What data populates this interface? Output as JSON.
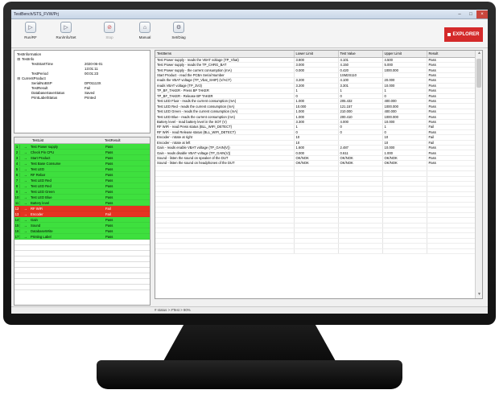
{
  "window": {
    "title": "TestBench/STS_FVW/Prj"
  },
  "toolbar": {
    "buttons": [
      {
        "label": "Run/RF",
        "icon": "play-icon",
        "glyph": "▷"
      },
      {
        "label": "Run/Info/Set",
        "icon": "play-icon",
        "glyph": "▷"
      },
      {
        "label": "Stop",
        "icon": "stop-icon",
        "glyph": "⊘"
      },
      {
        "label": "Manual",
        "icon": "home-icon",
        "glyph": "⌂"
      },
      {
        "label": "Set/Diag",
        "icon": "gear-icon",
        "glyph": "⚙"
      }
    ]
  },
  "brand": {
    "label": "EXPLORER",
    "color": "#d42a2a"
  },
  "test_info": {
    "header": "TestInformation",
    "rows": [
      {
        "key": "TestInfo",
        "value": "",
        "indent": 1,
        "expander": "⊟"
      },
      {
        "key": "TestStartTime",
        "value": "2020-06-01",
        "indent": 3,
        "expander": ""
      },
      {
        "key": "",
        "value": "13:01:11",
        "indent": 3,
        "expander": ""
      },
      {
        "key": "TestPeriod",
        "value": "00:01:23",
        "indent": 3,
        "expander": ""
      },
      {
        "key": "CurrentProduct",
        "value": "",
        "indent": 1,
        "expander": "⊟"
      },
      {
        "key": "SerialNoBSP",
        "value": "DP01113X",
        "indent": 3,
        "expander": ""
      },
      {
        "key": "TestResult",
        "value": "Fail",
        "indent": 3,
        "expander": ""
      },
      {
        "key": "DatabaseSaveStatus",
        "value": "Saved",
        "indent": 3,
        "expander": ""
      },
      {
        "key": "PrintLabelStatus",
        "value": "Printed",
        "indent": 3,
        "expander": ""
      }
    ]
  },
  "test_list": {
    "columns": {
      "name": "TestList",
      "result": "TestResult"
    },
    "rows": [
      {
        "index": "1",
        "name": "Test Power supply",
        "result": "Pass",
        "status": "pass"
      },
      {
        "index": "2",
        "name": "Check Pin CPU",
        "result": "Pass",
        "status": "pass"
      },
      {
        "index": "3",
        "name": "Start Product",
        "result": "Pass",
        "status": "pass"
      },
      {
        "index": "4",
        "name": "Test Base Consume",
        "result": "Pass",
        "status": "pass"
      },
      {
        "index": "5",
        "name": "Test LED",
        "result": "Pass",
        "status": "pass"
      },
      {
        "index": "6",
        "name": "RF Rebar",
        "result": "Pass",
        "status": "pass"
      },
      {
        "index": "7",
        "name": "Test LED Red",
        "result": "Pass",
        "status": "pass"
      },
      {
        "index": "8",
        "name": "Test LED Red",
        "result": "Pass",
        "status": "pass"
      },
      {
        "index": "9",
        "name": "Test LED Green",
        "result": "Pass",
        "status": "pass"
      },
      {
        "index": "10",
        "name": "Test LED Blue",
        "result": "Pass",
        "status": "pass"
      },
      {
        "index": "11",
        "name": "Battery level",
        "result": "Pass",
        "status": "pass"
      },
      {
        "index": "12",
        "name": "RF WiFi",
        "result": "Fail",
        "status": "fail"
      },
      {
        "index": "13",
        "name": "Encoder",
        "result": "Fail",
        "status": "fail"
      },
      {
        "index": "14",
        "name": "Gain",
        "result": "Pass",
        "status": "pass"
      },
      {
        "index": "15",
        "name": "Sound",
        "result": "Pass",
        "status": "pass"
      },
      {
        "index": "16",
        "name": "DatabaseWrite",
        "result": "Pass",
        "status": "pass"
      },
      {
        "index": "17",
        "name": "Printing Label",
        "result": "Pass",
        "status": "pass"
      }
    ],
    "empty_rows": 9
  },
  "results_table": {
    "columns": [
      "TestItems",
      "Lower Limit",
      "Test Value",
      "Upper Limit",
      "Result"
    ],
    "rows": [
      [
        "Test Power supply - reads the VBAT voltage (TP_Vbat)",
        "3.800",
        "4.101",
        "4.500",
        "Pass"
      ],
      [
        "Test Power supply - reads the TP_CHRG_BAT",
        "3.000",
        "4.150",
        "5.000",
        "Pass"
      ],
      [
        "Test Power supply - the current consumption (mA)",
        "0.000",
        "0.420",
        "1000.000",
        "Pass"
      ],
      [
        "Start Product - read the PCBA Serial Number",
        "",
        "1SM2S110",
        "",
        "Pass"
      ],
      [
        "reads the VBAT voltage (TP_Vbat_SHIP) (V/ACT)",
        "3.200",
        "4.100",
        "20.000",
        "Pass"
      ],
      [
        "reads VBAT voltage (TP_3V3)",
        "3.200",
        "3.301",
        "10.000",
        "Pass"
      ],
      [
        "TP_BF_TAKER - Press BP TAKER",
        "1",
        "1",
        "1",
        "Pass"
      ],
      [
        "TP_BF_TAKER - Release BP TAKER",
        "0",
        "0",
        "0",
        "Pass"
      ],
      [
        "Test LED Fluor - reads the current consumption (mA)",
        "1.000",
        "205.432",
        "400.000",
        "Pass"
      ],
      [
        "Test LED Red - reads the current consumption (mA)",
        "10.000",
        "121.157",
        "1000.000",
        "Pass"
      ],
      [
        "Test LED Green - reads the current consumption (mA)",
        "1.000",
        "210.000",
        "400.000",
        "Pass"
      ],
      [
        "Test LED Blue - reads the current consumption (mA)",
        "1.000",
        "200.410",
        "1000.000",
        "Pass"
      ],
      [
        "Battery level - read battery level in the SOT (V)",
        "3.300",
        "4.000",
        "10.000",
        "Pass"
      ],
      [
        "RF WiFi - read Press status (BLL_WIFI_DETECT)",
        "1",
        "0",
        "1",
        "Fail"
      ],
      [
        "RF WiFi - read Release status (BLL_WIFI_DETECT)",
        "0",
        "0",
        "0",
        "Pass"
      ],
      [
        "Encoder - rotate at right",
        "10",
        "",
        "10",
        "Fail"
      ],
      [
        "Encoder - rotate at left",
        "10",
        "",
        "10",
        "Fail"
      ],
      [
        "Gain - reads enable VBAT voltage (TP_GAIN(V))",
        "1.600",
        "2.487",
        "10.000",
        "Pass"
      ],
      [
        "Gain - reads disable VBAT voltage (TP_GAIN(V))",
        "0.000",
        "0.611",
        "1.000",
        "Pass"
      ],
      [
        "Sound - listen the sound on speaker of the DUT",
        "OK/NOK",
        "OK/NOK",
        "OK/NOK",
        "Pass"
      ],
      [
        "Sound - listen the sound on headphones of the DUT",
        "OK/NOK",
        "OK/NOK",
        "OK/NOK",
        "Pass"
      ]
    ],
    "empty_rows": 17
  },
  "status": {
    "text": "# status > #Test > 90%"
  }
}
